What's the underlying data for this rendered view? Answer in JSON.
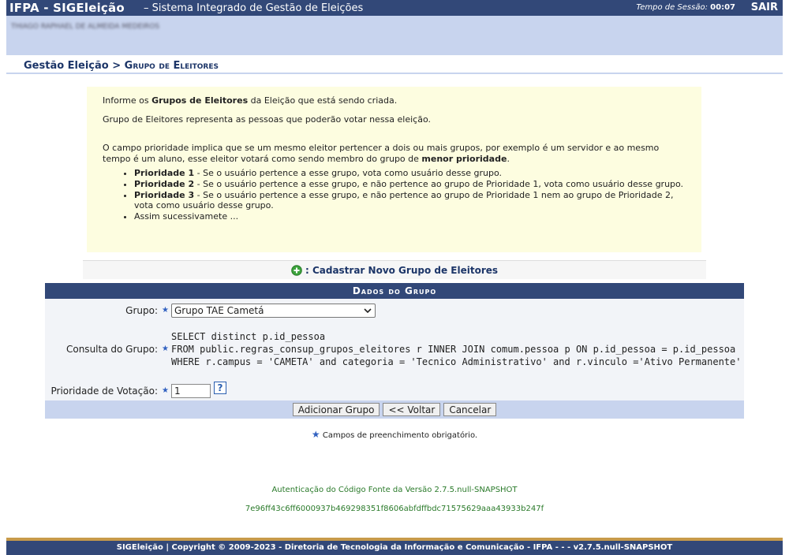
{
  "header": {
    "app_name": "IFPA - SIGEleição",
    "subtitle": "– Sistema Integrado de Gestão de Eleições",
    "session_label": "Tempo de Sessão:",
    "session_value": "00:07",
    "logout": "SAIR"
  },
  "user": {
    "name": "THIAGO RAPHAEL DE ALMEIDA MEDEIROS"
  },
  "breadcrumb": {
    "section": "Gestão Eleição",
    "separator": ">",
    "page": "Grupo de Eleitores"
  },
  "info": {
    "intro_prefix": "Informe os ",
    "intro_bold": "Grupos de Eleitores",
    "intro_suffix": " da Eleição que está sendo criada.",
    "definition": "Grupo de Eleitores representa as pessoas que poderão votar nessa eleição.",
    "priority_text": "O campo prioridade implica que se um mesmo eleitor pertencer a dois ou mais grupos, por exemplo é um servidor e ao mesmo tempo é um aluno, esse eleitor votará como sendo membro do grupo de ",
    "priority_bold": "menor prioridade",
    "priority_end": ".",
    "items": [
      {
        "bold": "Prioridade 1",
        "text": " - Se o usuário pertence a esse grupo, vota como usuário desse grupo."
      },
      {
        "bold": "Prioridade 2",
        "text": " - Se o usuário pertence a esse grupo, e não pertence ao grupo de Prioridade 1, vota como usuário desse grupo."
      },
      {
        "bold": "Prioridade 3",
        "text": " - Se o usuário pertence a esse grupo, e não pertence ao grupo de Prioridade 1 nem ao grupo de Prioridade 2, vota como usuário desse grupo."
      },
      {
        "bold": "",
        "text": "Assim sucessivamete ..."
      }
    ]
  },
  "action": {
    "add_label": ": Cadastrar Novo Grupo de Eleitores"
  },
  "form": {
    "title": "Dados do Grupo",
    "group_label": "Grupo:",
    "group_value": "Grupo TAE Cametá",
    "query_label": "Consulta do Grupo:",
    "query_lines": [
      "SELECT distinct p.id_pessoa",
      "FROM public.regras_consup_grupos_eleitores r INNER JOIN comum.pessoa p ON p.id_pessoa = p.id_pessoa",
      "WHERE r.campus = 'CAMETA' and categoria = 'Tecnico Administrativo' and r.vinculo ='Ativo Permanente'"
    ],
    "priority_label": "Prioridade de Votação:",
    "priority_value": "1",
    "help": "?",
    "buttons": {
      "add": "Adicionar Grupo",
      "back": "<< Voltar",
      "cancel": "Cancelar"
    }
  },
  "required_note": "Campos de preenchimento obrigatório.",
  "auth": {
    "label": "Autenticação do Código Fonte da Versão 2.7.5.null-SNAPSHOT",
    "hash": "7e96ff43c6ff6000937b469298351f8606abfdffbdc71575629aaa43933b247f"
  },
  "footer": {
    "text": "SIGEleição | Copyright © 2009-2023 - Diretoria de Tecnologia da Informação e Comunicação - IFPA - - - v2.7.5.null-SNAPSHOT"
  },
  "colors": {
    "header": "#324878",
    "light_band": "#c8d4ee",
    "info_bg": "#fdfde0",
    "required_star": "#3060c0",
    "auth_text": "#2a7a2a"
  }
}
